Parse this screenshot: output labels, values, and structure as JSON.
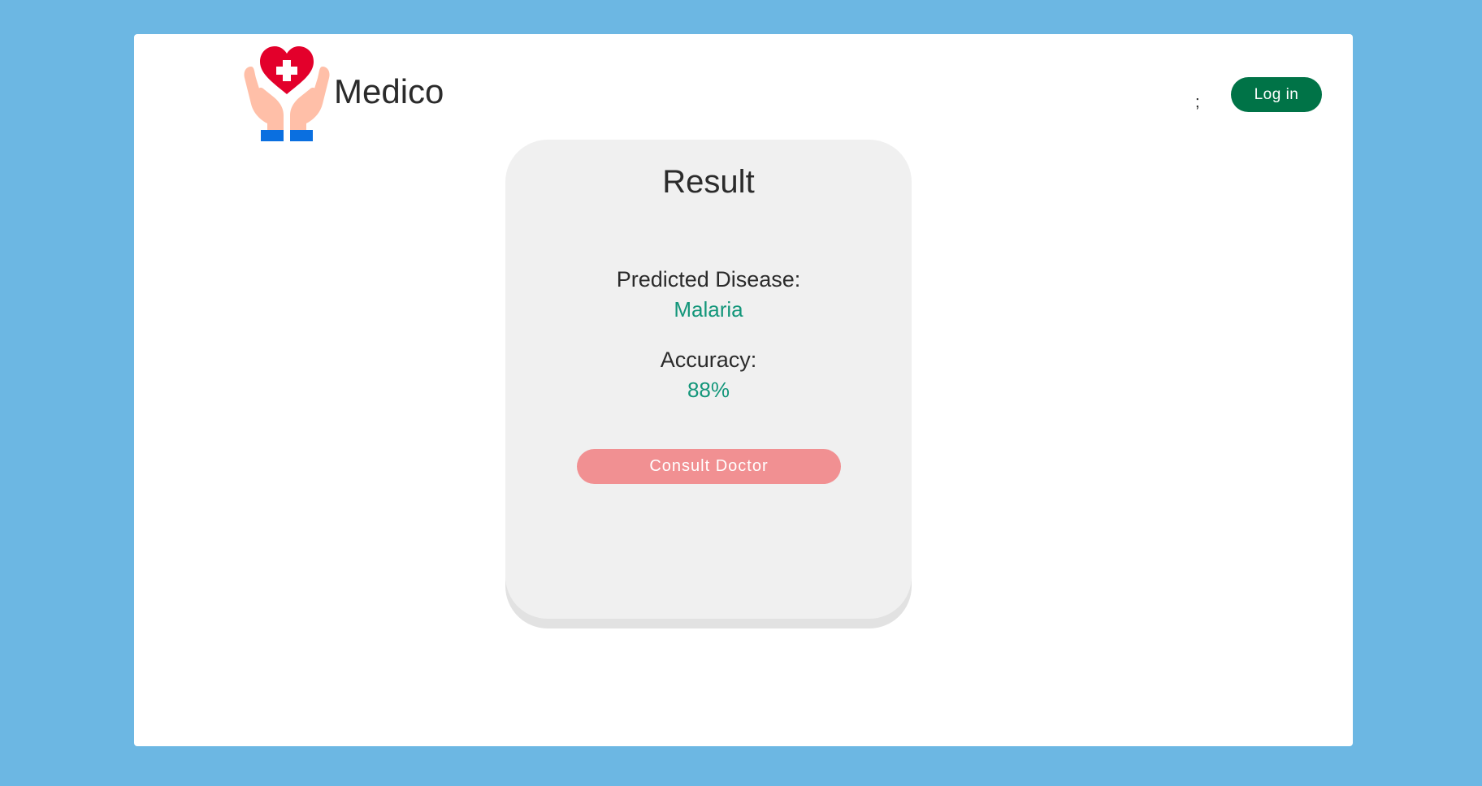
{
  "header": {
    "brand": "Medico",
    "logo_icon": "heart-hands-medical-icon",
    "separator": ";",
    "login_label": "Log in"
  },
  "result_card": {
    "title": "Result",
    "disease_label": "Predicted Disease:",
    "disease_value": "Malaria",
    "accuracy_label": "Accuracy:",
    "accuracy_value": "88%",
    "consult_label": "Consult Doctor"
  },
  "colors": {
    "page_background": "#6cb7e3",
    "login_button": "#007347",
    "consult_button": "#f19092",
    "value_text": "#13967a",
    "card_background": "#f0f0f0"
  }
}
